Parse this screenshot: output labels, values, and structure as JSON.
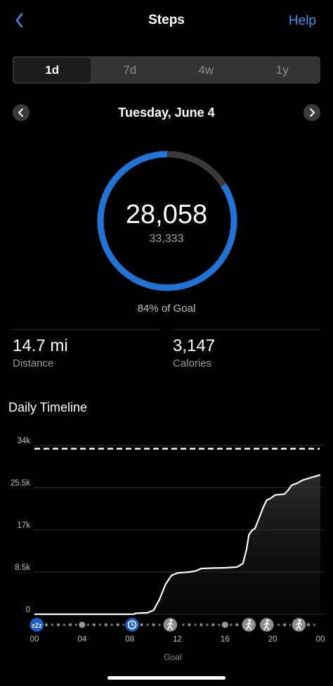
{
  "header": {
    "title": "Steps",
    "help_label": "Help"
  },
  "periods": [
    {
      "label": "1d",
      "active": true
    },
    {
      "label": "7d",
      "active": false
    },
    {
      "label": "4w",
      "active": false
    },
    {
      "label": "1y",
      "active": false
    }
  ],
  "date_label": "Tuesday, June 4",
  "summary": {
    "steps": "28,058",
    "goal": "33,333",
    "goal_percent_label": "84% of Goal",
    "progress_fraction": 0.84
  },
  "stats": {
    "distance_value": "14.7 mi",
    "distance_label": "Distance",
    "calories_value": "3,147",
    "calories_label": "Calories"
  },
  "timeline_title": "Daily Timeline",
  "colors": {
    "accent": "#4a8ee6",
    "ring": "#2273d6",
    "ring_track": "#3a3a3a",
    "background": "#000000"
  },
  "chart_data": {
    "type": "area",
    "title": "",
    "xlabel": "Goal",
    "ylabel": "",
    "y_ticks": [
      {
        "label": "34k",
        "value": 34000
      },
      {
        "label": "25.5k",
        "value": 25500
      },
      {
        "label": "17k",
        "value": 17000
      },
      {
        "label": "8.5k",
        "value": 8500
      },
      {
        "label": "0",
        "value": 0
      }
    ],
    "x_ticks": [
      {
        "label": "00",
        "hour": 0
      },
      {
        "label": "04",
        "hour": 4
      },
      {
        "label": "08",
        "hour": 8
      },
      {
        "label": "12",
        "hour": 12
      },
      {
        "label": "16",
        "hour": 16
      },
      {
        "label": "20",
        "hour": 20
      },
      {
        "label": "00",
        "hour": 24
      }
    ],
    "ylim": [
      0,
      34000
    ],
    "xlim": [
      0,
      24
    ],
    "goal_line": 33333,
    "series": [
      {
        "name": "",
        "points": [
          [
            0,
            0
          ],
          [
            8.3,
            0
          ],
          [
            8.5,
            200
          ],
          [
            9.5,
            300
          ],
          [
            10.0,
            800
          ],
          [
            10.5,
            3000
          ],
          [
            11.0,
            6000
          ],
          [
            11.5,
            7800
          ],
          [
            12.0,
            8300
          ],
          [
            12.5,
            8400
          ],
          [
            13.0,
            8500
          ],
          [
            13.5,
            8700
          ],
          [
            14.0,
            9200
          ],
          [
            15.0,
            9300
          ],
          [
            16.0,
            9350
          ],
          [
            17.0,
            9500
          ],
          [
            17.5,
            10200
          ],
          [
            17.8,
            13000
          ],
          [
            18.0,
            16000
          ],
          [
            18.3,
            17000
          ],
          [
            18.5,
            17200
          ],
          [
            18.8,
            19000
          ],
          [
            19.2,
            21500
          ],
          [
            19.5,
            23000
          ],
          [
            19.8,
            23300
          ],
          [
            20.2,
            24000
          ],
          [
            21.0,
            24200
          ],
          [
            21.3,
            25000
          ],
          [
            21.6,
            26000
          ],
          [
            22.0,
            26300
          ],
          [
            22.5,
            27000
          ],
          [
            23.2,
            27500
          ],
          [
            24.0,
            28058
          ]
        ]
      }
    ],
    "activity_markers": [
      {
        "hour": 0.2,
        "icon": "sleep-icon",
        "color": "#1f5fc8"
      },
      {
        "hour": 8.2,
        "icon": "clock-icon",
        "color": "#1f5fc8"
      },
      {
        "hour": 11.4,
        "icon": "walk-icon",
        "color": "#8e8e8e"
      },
      {
        "hour": 18.0,
        "icon": "run-icon",
        "color": "#8e8e8e"
      },
      {
        "hour": 19.5,
        "icon": "walk-icon",
        "color": "#8e8e8e"
      },
      {
        "hour": 22.2,
        "icon": "walk-icon",
        "color": "#8e8e8e"
      }
    ],
    "hour_dots": [
      1,
      2,
      3,
      4,
      5,
      6,
      7,
      9,
      10,
      13,
      14,
      15,
      16,
      17,
      21,
      23
    ]
  }
}
